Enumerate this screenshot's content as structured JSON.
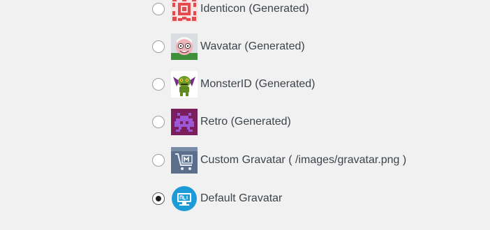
{
  "avatar_options": [
    {
      "label": "Identicon (Generated)",
      "icon": "identicon-icon",
      "selected": false
    },
    {
      "label": "Wavatar (Generated)",
      "icon": "wavatar-icon",
      "selected": false
    },
    {
      "label": "MonsterID (Generated)",
      "icon": "monsterid-icon",
      "selected": false
    },
    {
      "label": "Retro (Generated)",
      "icon": "retro-icon",
      "selected": false
    },
    {
      "label": "Custom Gravatar ( /images/gravatar.png )",
      "icon": "custom-gravatar-icon",
      "selected": false
    },
    {
      "label": "Default Gravatar",
      "icon": "default-gravatar-icon",
      "selected": true
    }
  ],
  "colors": {
    "background": "#f1f1f1",
    "text": "#3c434a",
    "radio_border": "#9aa0a6",
    "radio_dot": "#1e1e1e",
    "identicon": "#e5484d",
    "retro_bg": "#7a1f5c",
    "retro_fg": "#9b57d6",
    "default_gravatar": "#1d9bd7"
  }
}
